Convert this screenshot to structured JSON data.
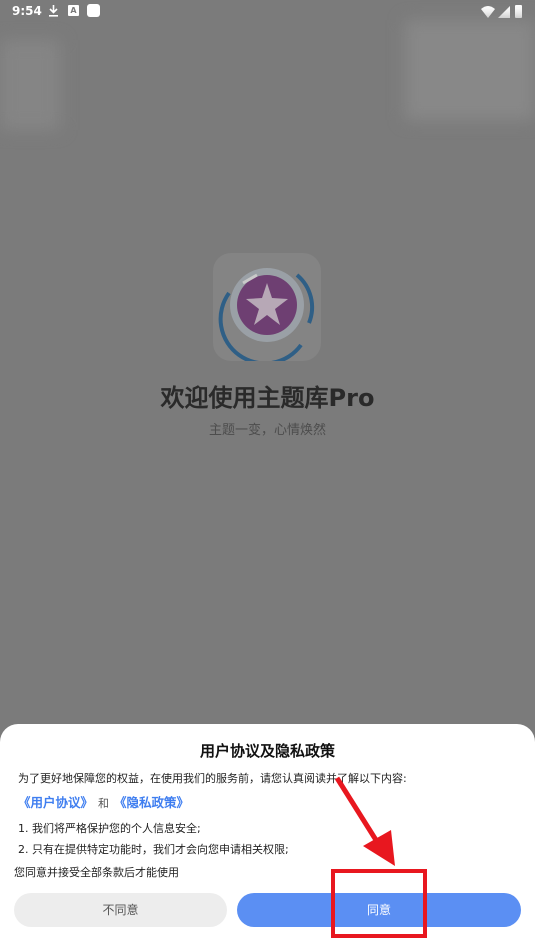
{
  "status_bar": {
    "time": "9:54",
    "a_badge": "A"
  },
  "splash": {
    "logo_icon": "star-logo-icon",
    "title": "欢迎使用主题库Pro",
    "subtitle": "主题一变，心情焕然"
  },
  "dialog": {
    "title": "用户协议及隐私政策",
    "intro": "为了更好地保障您的权益，在使用我们的服务前，请您认真阅读并了解以下内容:",
    "user_agreement_link": "《用户协议》",
    "and_text": "和",
    "privacy_policy_link": "《隐私政策》",
    "point1": "1. 我们将严格保护您的个人信息安全;",
    "point2": "2. 只有在提供特定功能时，我们才会向您申请相关权限;",
    "consent": "您同意并接受全部条款后才能使用",
    "disagree_label": "不同意",
    "agree_label": "同意"
  },
  "colors": {
    "overlay": "#7b7b7b",
    "accent": "#5b8ff3",
    "link": "#3f7ef0",
    "annotation": "#e8171f"
  }
}
